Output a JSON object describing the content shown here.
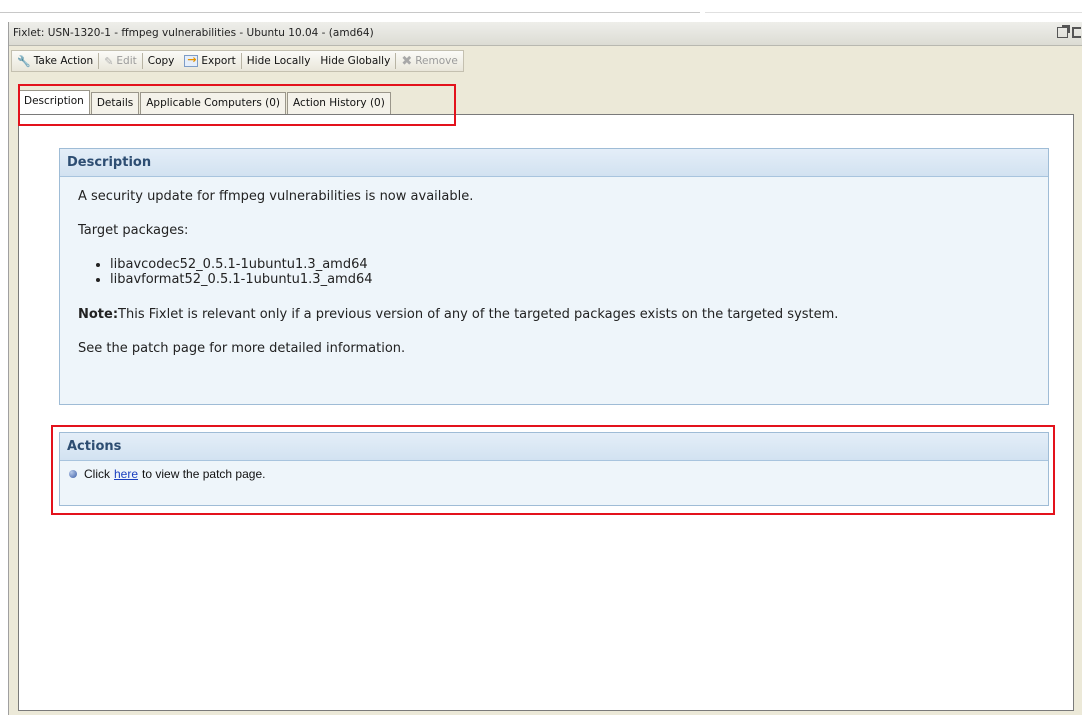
{
  "window": {
    "title": "Fixlet: USN-1320-1 - ffmpeg vulnerabilities - Ubuntu 10.04 - (amd64)"
  },
  "toolbar": {
    "take_action": "Take Action",
    "edit": "Edit",
    "copy": "Copy",
    "export": "Export",
    "hide_locally": "Hide Locally",
    "hide_globally": "Hide Globally",
    "remove": "Remove"
  },
  "tabs": [
    {
      "label": "Description",
      "active": true
    },
    {
      "label": "Details",
      "active": false
    },
    {
      "label": "Applicable Computers (0)",
      "active": false
    },
    {
      "label": "Action History (0)",
      "active": false
    }
  ],
  "description": {
    "heading": "Description",
    "intro": "A security update for ffmpeg vulnerabilities is now available.",
    "packages_label": "Target packages:",
    "packages": [
      "libavcodec52_0.5.1-1ubuntu1.3_amd64",
      "libavformat52_0.5.1-1ubuntu1.3_amd64"
    ],
    "note_label": "Note:",
    "note_text": "This Fixlet is relevant only if a previous version of any of the targeted packages exists on the targeted system.",
    "see_more": "See the patch page for more detailed information."
  },
  "actions": {
    "heading": "Actions",
    "prefix": "Click",
    "link": "here",
    "suffix": "to view the patch page."
  },
  "colors": {
    "highlight": "#e3121c",
    "panel_heading": "#2d4d72",
    "link": "#1a3fbf"
  },
  "icons": [
    "wrench-icon",
    "pencil-icon",
    "export-icon",
    "remove-x-icon",
    "detach-icon",
    "maximize-icon",
    "bullet-icon"
  ]
}
